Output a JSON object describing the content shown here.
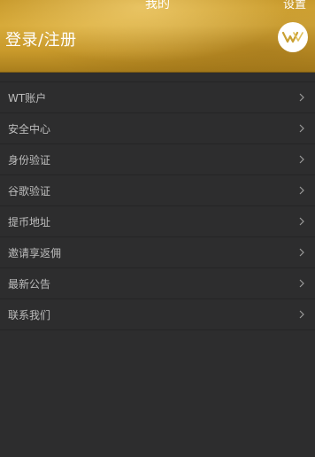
{
  "header": {
    "title": "我的",
    "settings_label": "设置",
    "login_label": "登录/注册",
    "avatar_icon": "w-logo-icon",
    "gold_color": "#cfa233"
  },
  "menu": {
    "items": [
      {
        "label": "WT账户",
        "icon": "chevron-right-icon"
      },
      {
        "label": "安全中心",
        "icon": "chevron-right-icon"
      },
      {
        "label": "身份验证",
        "icon": "chevron-right-icon"
      },
      {
        "label": "谷歌验证",
        "icon": "chevron-right-icon"
      },
      {
        "label": "提币地址",
        "icon": "chevron-right-icon"
      },
      {
        "label": "邀请享返佣",
        "icon": "chevron-right-icon"
      },
      {
        "label": "最新公告",
        "icon": "chevron-right-icon"
      },
      {
        "label": "联系我们",
        "icon": "chevron-right-icon"
      }
    ]
  },
  "background_color": "#2d2d2e"
}
